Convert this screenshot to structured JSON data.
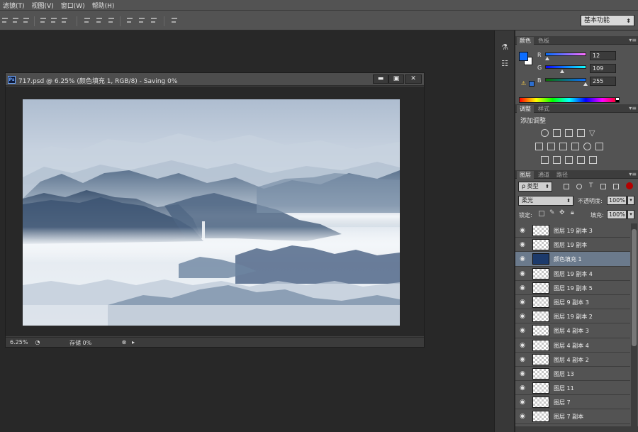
{
  "menubar": {
    "items": [
      "滤镜(T)",
      "视图(V)",
      "窗口(W)",
      "帮助(H)"
    ]
  },
  "options_bar": {
    "workspace": "基本功能"
  },
  "document": {
    "title": "717.psd @ 6.25% (颜色填充 1, RGB/8) - Saving 0%",
    "ps_icon": "Ps",
    "minimize": "▬",
    "maximize": "▣",
    "close": "✕",
    "zoom": "6.25%",
    "status": "存储 0%"
  },
  "color_panel": {
    "tabs": [
      "颜色",
      "色板"
    ],
    "r_label": "R",
    "g_label": "G",
    "b_label": "B",
    "r_value": "12",
    "g_value": "109",
    "b_value": "255",
    "foreground_color": "#0c6dff",
    "background_color": "#ffffff"
  },
  "adjustments_panel": {
    "tabs": [
      "调整",
      "样式"
    ],
    "title": "添加调整"
  },
  "layers_panel": {
    "tabs": [
      "图层",
      "通道",
      "路径"
    ],
    "filter_label": "ρ 类型",
    "blend_mode": "柔光",
    "opacity_label": "不透明度:",
    "opacity_value": "100%",
    "lock_label": "锁定:",
    "fill_label": "填充:",
    "fill_value": "100%",
    "layers": [
      {
        "name": "图层 19 副本 3",
        "type": "pixel",
        "selected": false
      },
      {
        "name": "图层 19 副本",
        "type": "pixel",
        "selected": false
      },
      {
        "name": "颜色填充 1",
        "type": "fill",
        "selected": true
      },
      {
        "name": "图层 19 副本 4",
        "type": "pixel",
        "selected": false
      },
      {
        "name": "图层 19 副本 5",
        "type": "pixel",
        "selected": false
      },
      {
        "name": "图层 9 副本 3",
        "type": "pixel",
        "selected": false
      },
      {
        "name": "图层 19 副本 2",
        "type": "pixel",
        "selected": false
      },
      {
        "name": "图层 4 副本 3",
        "type": "pixel",
        "selected": false
      },
      {
        "name": "图层 4 副本 4",
        "type": "pixel",
        "selected": false
      },
      {
        "name": "图层 4 副本 2",
        "type": "pixel",
        "selected": false
      },
      {
        "name": "图层 13",
        "type": "pixel",
        "selected": false
      },
      {
        "name": "图层 11",
        "type": "pixel",
        "selected": false
      },
      {
        "name": "图层 7",
        "type": "pixel",
        "selected": false
      },
      {
        "name": "图层 7 副本",
        "type": "pixel",
        "selected": false
      }
    ]
  }
}
